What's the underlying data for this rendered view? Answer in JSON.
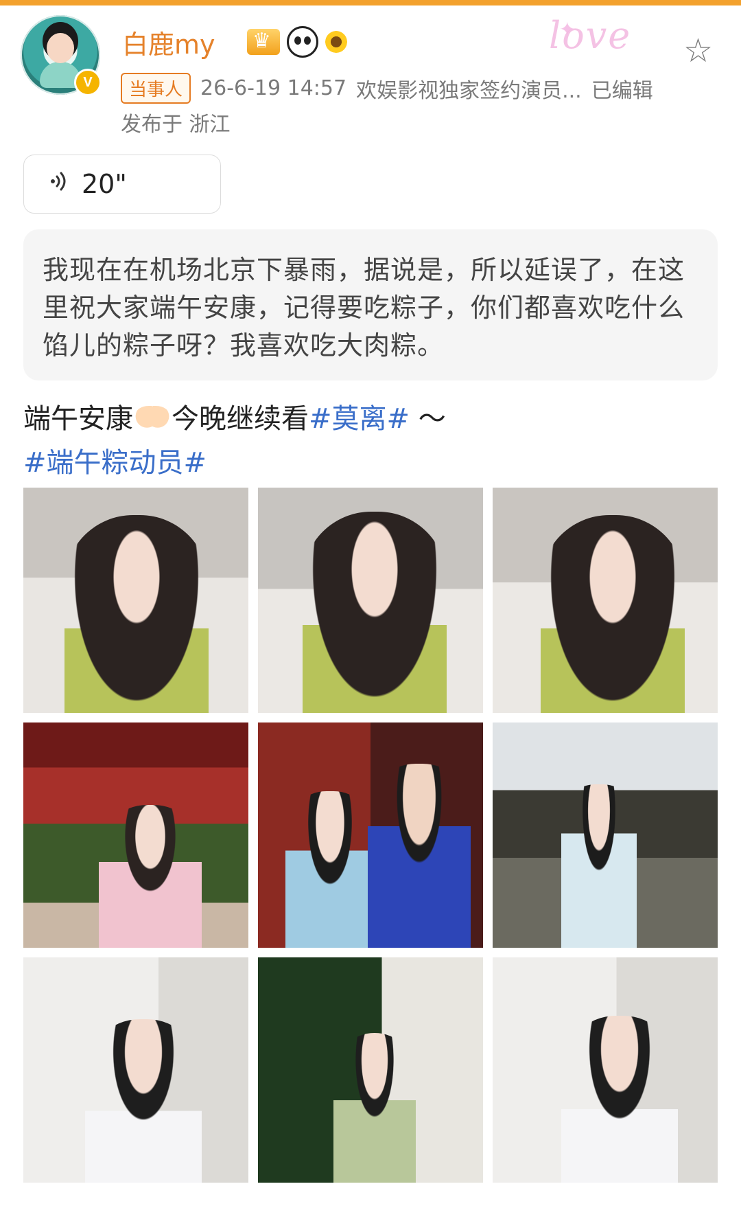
{
  "post": {
    "username": "白鹿my",
    "tag": "当事人",
    "time": "26-6-19 14:57",
    "bio": "欢娱影视独家签约演员...",
    "edited": "已编辑",
    "location": "发布于 浙江",
    "voice_duration": "20\"",
    "transcript": "我现在在机场北京下暴雨，据说是，所以延误了，在这里祝大家端午安康，记得要吃粽子，你们都喜欢吃什么馅儿的粽子呀？我喜欢吃大肉粽。",
    "text_before": "端午安康",
    "text_mid": "今晚继续看",
    "hashtag1": "#莫离#",
    "text_after": " ～",
    "hashtag2": "#端午粽动员#",
    "love_text": "love"
  },
  "colors": {
    "accent_orange": "#e5822b",
    "hashtag_blue": "#3a6ec9",
    "meta_gray": "#7a7a7a"
  },
  "icons": {
    "voice": "sound-wave-icon",
    "favorite": "star-icon",
    "verified": "verified-v-badge"
  },
  "photos": [
    {
      "name": "photo-1"
    },
    {
      "name": "photo-2"
    },
    {
      "name": "photo-3"
    },
    {
      "name": "photo-4"
    },
    {
      "name": "photo-5"
    },
    {
      "name": "photo-6"
    },
    {
      "name": "photo-7"
    },
    {
      "name": "photo-8"
    },
    {
      "name": "photo-9"
    }
  ]
}
